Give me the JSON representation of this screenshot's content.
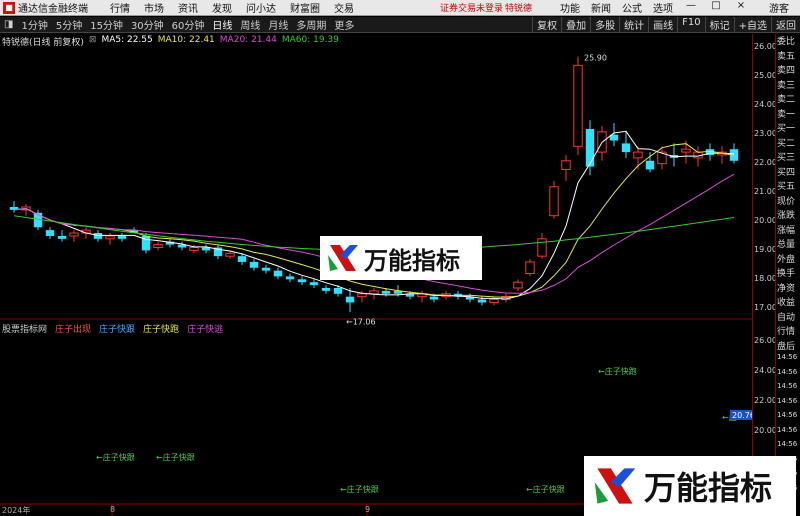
{
  "menubar": {
    "app_title": "通达信金融终端",
    "menus": [
      "行情",
      "市场",
      "资讯",
      "发现",
      "问小达",
      "财富圈",
      "交易"
    ],
    "notice": "证券交易未登录",
    "notice2": "特锐德",
    "right_items": [
      "功能",
      "新闻",
      "公式",
      "选项"
    ],
    "guest": "游客"
  },
  "toolbar": {
    "tabs": [
      "1分钟",
      "5分钟",
      "15分钟",
      "30分钟",
      "60分钟",
      "日线",
      "周线",
      "月线",
      "多周期",
      "更多"
    ],
    "active_tab": "日线",
    "right_buttons": [
      "复权",
      "叠加",
      "多股",
      "统计",
      "画线",
      "F10",
      "标记",
      "+自选",
      "返回"
    ]
  },
  "legend": {
    "stock": "特锐德(日线 前复权)",
    "ma5": "MA5: 22.55",
    "ma10": "MA10: 22.41",
    "ma20": "MA20: 21.44",
    "ma60": "MA60: 19.39"
  },
  "legend_colors": {
    "ma5": "#ffffff",
    "ma10": "#e6e64d",
    "ma20": "#d94dd9",
    "ma60": "#33cc33"
  },
  "indicator": {
    "name": "股票指标网",
    "lines": [
      "庄子出现",
      "庄子快跟",
      "庄子快跑",
      "庄子快逃"
    ],
    "annotations": [
      "←庄子快跑",
      "←庄子快跟",
      "←庄子快跟",
      "←庄子快跟",
      "←庄子快跟",
      "←庄"
    ],
    "value_box": "20.76"
  },
  "yaxis_main": [
    "26.00",
    "25.00",
    "24.00",
    "23.00",
    "22.00",
    "21.00",
    "20.00",
    "19.00",
    "18.00",
    "17.00"
  ],
  "yaxis_sub": [
    "26.00",
    "24.00",
    "22.00",
    "20.00"
  ],
  "side_labels": [
    "委比",
    "卖五",
    "卖四",
    "卖三",
    "卖二",
    "卖一",
    "买一",
    "买二",
    "买三",
    "买四",
    "买五",
    "现价",
    "涨跌",
    "涨幅",
    "总量",
    "外盘",
    "换手",
    "净资",
    "收益",
    "自动",
    "行情",
    "盘后",
    "14:56",
    "14:56",
    "14:56",
    "14:56",
    "14:56",
    "14:56",
    "14:56",
    "14:56",
    "14:56",
    "14:56"
  ],
  "xaxis": [
    "2024年",
    "8",
    "9"
  ],
  "annotations_price": [
    "25.90",
    "←17.06"
  ],
  "watermark": "万能指标",
  "chart_data": {
    "type": "candlestick",
    "title": "特锐德(日线 前复权)",
    "ylim": [
      17,
      26.2
    ],
    "candles": [
      [
        20.7,
        20.9,
        20.5,
        20.6
      ],
      [
        20.6,
        20.8,
        20.4,
        20.7
      ],
      [
        20.5,
        20.6,
        19.9,
        20.0
      ],
      [
        19.9,
        20.0,
        19.6,
        19.7
      ],
      [
        19.7,
        19.9,
        19.5,
        19.6
      ],
      [
        19.7,
        19.9,
        19.5,
        19.8
      ],
      [
        19.8,
        20.0,
        19.6,
        19.9
      ],
      [
        19.8,
        19.9,
        19.5,
        19.6
      ],
      [
        19.6,
        19.8,
        19.4,
        19.7
      ],
      [
        19.7,
        19.8,
        19.5,
        19.6
      ],
      [
        19.9,
        20.0,
        19.8,
        19.8
      ],
      [
        19.7,
        19.8,
        19.1,
        19.2
      ],
      [
        19.3,
        19.5,
        19.2,
        19.4
      ],
      [
        19.5,
        19.6,
        19.3,
        19.4
      ],
      [
        19.4,
        19.5,
        19.2,
        19.3
      ],
      [
        19.2,
        19.4,
        19.1,
        19.3
      ],
      [
        19.3,
        19.4,
        19.1,
        19.2
      ],
      [
        19.3,
        19.4,
        18.9,
        19.0
      ],
      [
        19.0,
        19.2,
        18.9,
        19.1
      ],
      [
        19.0,
        19.1,
        18.7,
        18.8
      ],
      [
        18.8,
        18.9,
        18.5,
        18.6
      ],
      [
        18.6,
        18.7,
        18.4,
        18.5
      ],
      [
        18.5,
        18.6,
        18.2,
        18.3
      ],
      [
        18.3,
        18.4,
        18.1,
        18.2
      ],
      [
        18.2,
        18.3,
        18.0,
        18.1
      ],
      [
        18.1,
        18.2,
        17.9,
        18.0
      ],
      [
        17.9,
        18.0,
        17.7,
        17.8
      ],
      [
        17.9,
        18.0,
        17.6,
        17.7
      ],
      [
        17.6,
        17.9,
        17.06,
        17.4
      ],
      [
        17.6,
        17.8,
        17.4,
        17.7
      ],
      [
        17.7,
        17.9,
        17.5,
        17.8
      ],
      [
        17.8,
        17.9,
        17.6,
        17.7
      ],
      [
        17.8,
        18.0,
        17.6,
        17.7
      ],
      [
        17.7,
        17.8,
        17.5,
        17.6
      ],
      [
        17.6,
        17.8,
        17.4,
        17.7
      ],
      [
        17.6,
        17.7,
        17.4,
        17.5
      ],
      [
        17.6,
        17.8,
        17.5,
        17.7
      ],
      [
        17.7,
        17.8,
        17.5,
        17.6
      ],
      [
        17.6,
        17.7,
        17.4,
        17.5
      ],
      [
        17.5,
        17.6,
        17.3,
        17.4
      ],
      [
        17.4,
        17.6,
        17.3,
        17.5
      ],
      [
        17.5,
        17.7,
        17.4,
        17.6
      ],
      [
        17.9,
        18.2,
        17.8,
        18.1
      ],
      [
        18.4,
        18.9,
        18.3,
        18.8
      ],
      [
        19.0,
        19.8,
        18.9,
        19.6
      ],
      [
        20.4,
        21.6,
        20.3,
        21.4
      ],
      [
        22.0,
        22.5,
        21.6,
        22.3
      ],
      [
        22.8,
        25.9,
        22.5,
        25.6
      ],
      [
        23.4,
        23.7,
        21.8,
        22.1
      ],
      [
        22.6,
        23.5,
        22.3,
        23.3
      ],
      [
        23.2,
        23.6,
        22.8,
        23.0
      ],
      [
        22.9,
        23.3,
        22.4,
        22.6
      ],
      [
        22.4,
        22.8,
        22.0,
        22.6
      ],
      [
        22.3,
        22.6,
        21.9,
        22.0
      ],
      [
        22.2,
        22.8,
        22.0,
        22.6
      ],
      [
        22.5,
        22.9,
        22.1,
        22.4
      ],
      [
        22.6,
        23.0,
        22.2,
        22.7
      ],
      [
        22.4,
        22.8,
        22.1,
        22.6
      ],
      [
        22.7,
        22.9,
        22.3,
        22.5
      ],
      [
        22.5,
        22.8,
        22.2,
        22.6
      ],
      [
        22.7,
        22.9,
        22.2,
        22.3
      ]
    ]
  }
}
